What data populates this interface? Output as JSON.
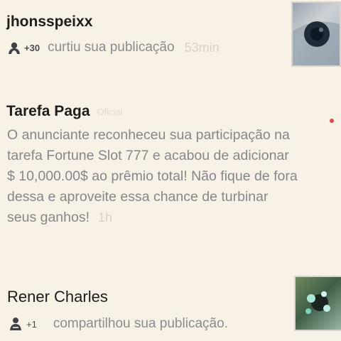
{
  "notifications": [
    {
      "username": "jhonsspeixx",
      "count": "+30",
      "action": "curtiu sua publicação",
      "time": "53min",
      "icon": "users-group-icon"
    },
    {
      "title": "Tarefa Paga",
      "badge": "Oficial",
      "message": "O anunciante reconheceu sua participação na tarefa Fortune Slot 777 e acabou de adicionar $ 10,000.00$ ao prêmio total! Não fique de fora dessa e aproveite essa chance de turbinar seus ganhos!",
      "time": "1h",
      "unread": true,
      "unread_color": "#e5474a"
    },
    {
      "username": "Rener Charles",
      "count": "+1",
      "action": "compartilhou sua publicação.",
      "icon": "share-user-icon"
    }
  ]
}
